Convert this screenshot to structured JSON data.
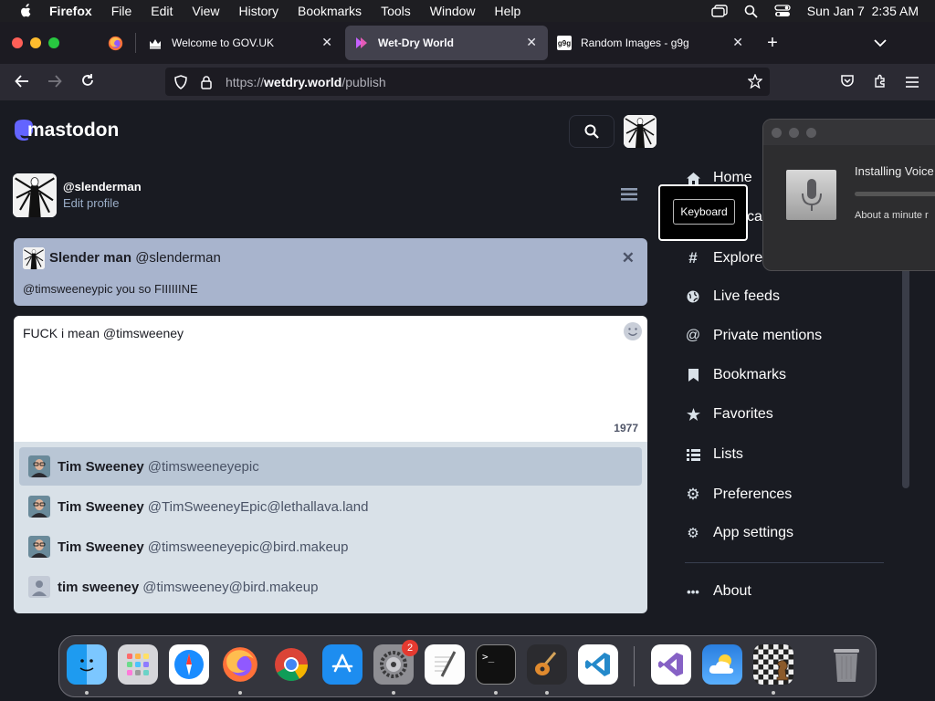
{
  "menubar": {
    "app_name": "Firefox",
    "items": [
      "File",
      "Edit",
      "View",
      "History",
      "Bookmarks",
      "Tools",
      "Window",
      "Help"
    ],
    "datetime": "Sun Jan 7  2:35 AM"
  },
  "browser": {
    "tabs": [
      {
        "title": "Welcome to GOV.UK",
        "active": false
      },
      {
        "title": "Wet-Dry World",
        "active": true
      },
      {
        "title": "Random Images - g9g",
        "active": false
      }
    ],
    "url_scheme": "https://",
    "url_host": "wetdry.world",
    "url_path": "/publish"
  },
  "mastodon": {
    "logo_text": "mastodon",
    "user": {
      "handle": "@slenderman",
      "edit_label": "Edit profile"
    },
    "reply_to": {
      "display_name": "Slender man",
      "handle": "@slenderman",
      "text": "@timsweeneypic you so FIIIIIINE"
    },
    "compose": {
      "text": "FUCK i mean @timsweeney",
      "char_count": "1977"
    },
    "suggestions": [
      {
        "name": "Tim Sweeney",
        "acct": "@timsweeneyepic",
        "selected": true
      },
      {
        "name": "Tim Sweeney",
        "acct": "@TimSweeneyEpic@lethallava.land",
        "selected": false
      },
      {
        "name": "Tim Sweeney",
        "acct": "@timsweeneyepic@bird.makeup",
        "selected": false
      },
      {
        "name": "tim sweeney",
        "acct": "@timsweeney@bird.makeup",
        "selected": false
      }
    ],
    "nav": {
      "home": "Home",
      "local_fragment": "ca",
      "explore": "Explore",
      "live_feeds": "Live feeds",
      "private_mentions": "Private mentions",
      "bookmarks": "Bookmarks",
      "favorites": "Favorites",
      "lists": "Lists",
      "preferences": "Preferences",
      "app_settings": "App settings",
      "about": "About"
    }
  },
  "keyboard_popup": {
    "label": "Keyboard"
  },
  "voice_installer": {
    "title": "Installing Voice",
    "subtitle": "About a minute r"
  },
  "dock": {
    "apps": [
      "finder-icon",
      "launchpad-icon",
      "safari-icon",
      "firefox-icon",
      "chrome-icon",
      "app-store-icon",
      "system-settings-icon",
      "textedit-icon",
      "terminal-icon",
      "garageband-icon",
      "vscode-icon",
      "visual-studio-icon",
      "weather-icon",
      "chess-icon",
      "trash-icon"
    ],
    "settings_badge": "2",
    "terminal_glyph": ">_"
  },
  "colors": {
    "mastodon_bg": "#191b22",
    "reply_card_bg": "#a8b4cd",
    "suggestions_bg": "#d9e1e8",
    "suggestion_selected": "#b9c6d5",
    "mastodon_brand": "#6364ff"
  }
}
